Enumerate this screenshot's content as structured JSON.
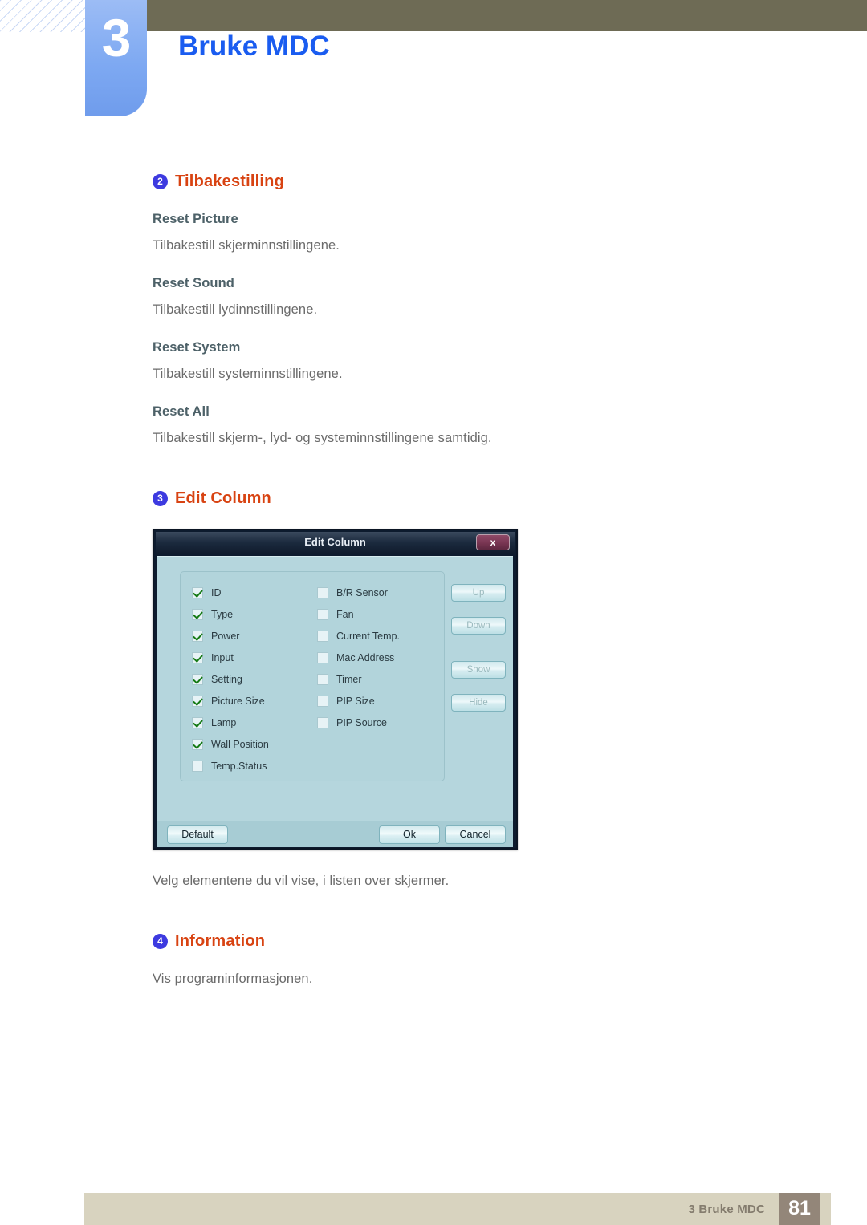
{
  "header": {
    "chapter_number": "3",
    "chapter_title": "Bruke MDC"
  },
  "sections": [
    {
      "badge": "2",
      "title": "Tilbakestilling",
      "items": [
        {
          "heading": "Reset Picture",
          "text": "Tilbakestill skjerminnstillingene."
        },
        {
          "heading": "Reset Sound",
          "text": "Tilbakestill lydinnstillingene."
        },
        {
          "heading": "Reset System",
          "text": "Tilbakestill systeminnstillingene."
        },
        {
          "heading": "Reset All",
          "text": "Tilbakestill skjerm-, lyd- og systeminnstillingene samtidig."
        }
      ]
    },
    {
      "badge": "3",
      "title": "Edit Column",
      "caption": "Velg elementene du vil vise, i listen over skjermer."
    },
    {
      "badge": "4",
      "title": "Information",
      "text": "Vis programinformasjonen."
    }
  ],
  "dialog": {
    "title": "Edit Column",
    "close_label": "x",
    "checkboxes_left": [
      {
        "label": "ID",
        "checked": true
      },
      {
        "label": "Type",
        "checked": true
      },
      {
        "label": "Power",
        "checked": true
      },
      {
        "label": "Input",
        "checked": true
      },
      {
        "label": "Setting",
        "checked": true
      },
      {
        "label": "Picture Size",
        "checked": true
      },
      {
        "label": "Lamp",
        "checked": true
      },
      {
        "label": "Wall Position",
        "checked": true
      },
      {
        "label": "Temp.Status",
        "checked": false
      }
    ],
    "checkboxes_right": [
      {
        "label": "B/R Sensor",
        "checked": false
      },
      {
        "label": "Fan",
        "checked": false
      },
      {
        "label": "Current Temp.",
        "checked": false
      },
      {
        "label": "Mac Address",
        "checked": false
      },
      {
        "label": "Timer",
        "checked": false
      },
      {
        "label": "PIP Size",
        "checked": false
      },
      {
        "label": "PIP Source",
        "checked": false
      }
    ],
    "side_buttons": {
      "up": "Up",
      "down": "Down",
      "show": "Show",
      "hide": "Hide"
    },
    "footer_buttons": {
      "default": "Default",
      "ok": "Ok",
      "cancel": "Cancel"
    }
  },
  "footer": {
    "label": "3 Bruke MDC",
    "page_number": "81"
  },
  "colors": {
    "accent_heading": "#d84312",
    "badge": "#3d3ae0",
    "chapter_title": "#1a5cf0",
    "olive_bar": "#6e6b55",
    "footer_bar": "#d8d3bf",
    "footer_page_box": "#938679",
    "dialog_body": "#b5d6dd"
  }
}
